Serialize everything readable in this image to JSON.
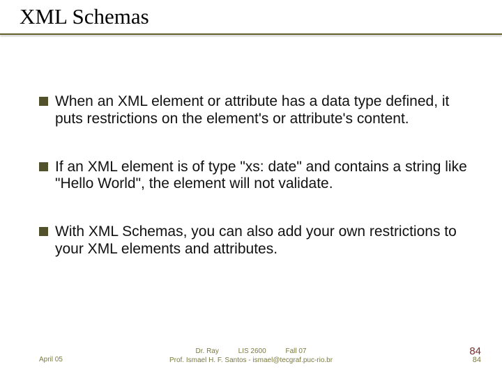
{
  "title": "XML Schemas",
  "bullets": [
    "When an XML element or attribute has a data type defined, it puts restrictions on the element's or attribute's content.",
    "If an XML element is of type \"xs: date\" and contains a string like \"Hello World\", the element will not validate.",
    "With XML Schemas, you can also add your own restrictions to your XML elements and attributes."
  ],
  "footer": {
    "left": "April 05",
    "center_line1": "Dr. Ray          LIS 2600          Fall 07",
    "center_line2": "Prof. Ismael H. F. Santos - ismael@tecgraf.puc-rio.br",
    "page_top": "84",
    "page_bottom": "84"
  }
}
